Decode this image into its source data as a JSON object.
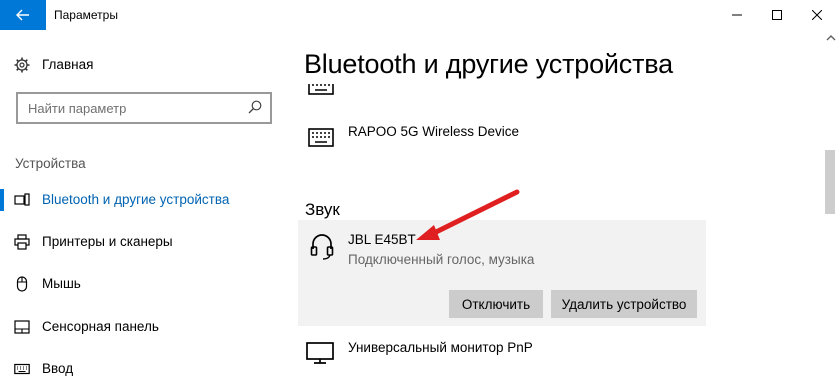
{
  "window": {
    "title": "Параметры",
    "back_icon": "back-arrow-icon",
    "controls": [
      "minimize-icon",
      "maximize-icon",
      "close-icon"
    ],
    "accent": "#0078d7"
  },
  "sidebar": {
    "home_label": "Главная",
    "search_placeholder": "Найти параметр",
    "section_label": "Устройства",
    "items": [
      {
        "label": "Bluetooth и другие устройства",
        "icon": "bluetooth-devices-icon",
        "active": true
      },
      {
        "label": "Принтеры и сканеры",
        "icon": "printer-icon",
        "active": false
      },
      {
        "label": "Мышь",
        "icon": "mouse-icon",
        "active": false
      },
      {
        "label": "Сенсорная панель",
        "icon": "touchpad-icon",
        "active": false
      },
      {
        "label": "Ввод",
        "icon": "keyboard-icon",
        "active": false
      }
    ]
  },
  "main": {
    "title": "Bluetooth и другие устройства",
    "devices_top": [
      {
        "name": "RAPOO 5G Wireless Device",
        "icon": "keyboard-icon"
      }
    ],
    "sound_group": {
      "header": "Звук",
      "device": {
        "name": "JBL E45BT",
        "status": "Подключенный голос, музыка",
        "icon": "headphones-icon",
        "disconnect_label": "Отключить",
        "remove_label": "Удалить устройство"
      }
    },
    "devices_bottom": [
      {
        "name": "Универсальный монитор PnP",
        "icon": "monitor-icon"
      }
    ],
    "annotation_color": "#e02020"
  }
}
